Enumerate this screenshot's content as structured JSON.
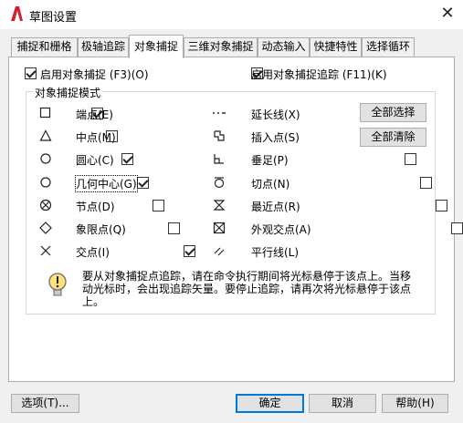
{
  "window": {
    "title": "草图设置",
    "close_label": "✕"
  },
  "tabs": [
    {
      "label": "捕捉和栅格",
      "active": false
    },
    {
      "label": "极轴追踪",
      "active": false
    },
    {
      "label": "对象捕捉",
      "active": true
    },
    {
      "label": "三维对象捕捉",
      "active": false
    },
    {
      "label": "动态输入",
      "active": false
    },
    {
      "label": "快捷特性",
      "active": false
    },
    {
      "label": "选择循环",
      "active": false
    }
  ],
  "options": {
    "enable_osnap": {
      "label": "启用对象捕捉 (F3)(O)",
      "checked": true
    },
    "enable_tracking": {
      "label": "启用对象捕捉追踪 (F11)(K)",
      "checked": true
    }
  },
  "group": {
    "title": "对象捕捉模式"
  },
  "snap_left": [
    {
      "symbol": "square-icon",
      "label": "端点(E)",
      "checked": true
    },
    {
      "symbol": "triangle-icon",
      "label": "中点(M)",
      "checked": false
    },
    {
      "symbol": "circle-icon",
      "label": "圆心(C)",
      "checked": true
    },
    {
      "symbol": "circle-icon",
      "label": "几何中心(G)",
      "checked": true
    },
    {
      "symbol": "node-icon",
      "label": "节点(D)",
      "checked": false
    },
    {
      "symbol": "diamond-icon",
      "label": "象限点(Q)",
      "checked": false
    },
    {
      "symbol": "cross-icon",
      "label": "交点(I)",
      "checked": true
    }
  ],
  "snap_right": [
    {
      "symbol": "extension-icon",
      "label": "延长线(X)",
      "checked": true
    },
    {
      "symbol": "insertion-icon",
      "label": "插入点(S)",
      "checked": false
    },
    {
      "symbol": "perpendicular-icon",
      "label": "垂足(P)",
      "checked": false
    },
    {
      "symbol": "tangent-icon",
      "label": "切点(N)",
      "checked": false
    },
    {
      "symbol": "nearest-icon",
      "label": "最近点(R)",
      "checked": false
    },
    {
      "symbol": "apparent-intersection-icon",
      "label": "外观交点(A)",
      "checked": false
    },
    {
      "symbol": "parallel-icon",
      "label": "平行线(L)",
      "checked": false
    }
  ],
  "buttons": {
    "select_all": "全部选择",
    "clear_all": "全部清除",
    "options": "选项(T)...",
    "ok": "确定",
    "cancel": "取消",
    "help": "帮助(H)"
  },
  "hint": "要从对象捕捉点追踪，请在命令执行期间将光标悬停于该点上。当移动光标时，会出现追踪矢量。要停止追踪，请再次将光标悬停于该点上。"
}
